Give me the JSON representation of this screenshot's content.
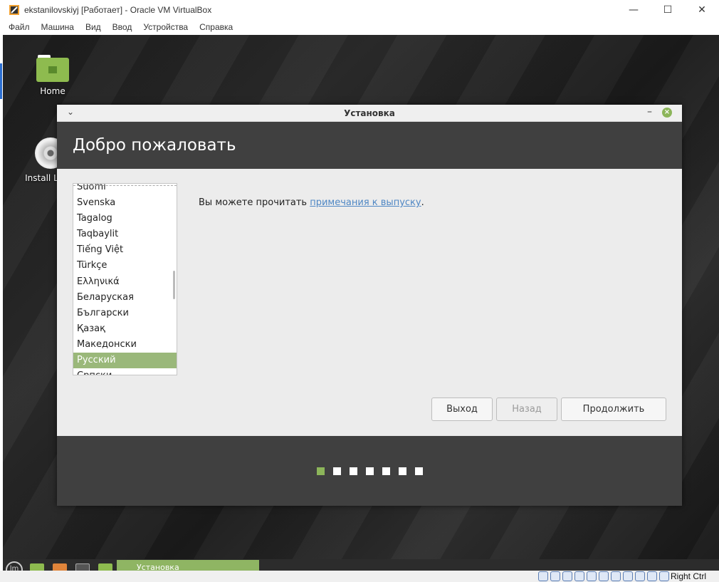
{
  "host": {
    "title": "ekstanilovskiyj [Работает] - Oracle VM VirtualBox",
    "menu": [
      "Файл",
      "Машина",
      "Вид",
      "Ввод",
      "Устройства",
      "Справка"
    ],
    "controls": {
      "minimize": "—",
      "maximize": "☐",
      "close": "✕"
    },
    "status_key": "Right Ctrl"
  },
  "desktop": {
    "icons": [
      {
        "label": "Home",
        "icon": "folder-home-icon"
      },
      {
        "label": "Install L Min",
        "icon": "disc-icon"
      }
    ]
  },
  "dialog": {
    "title": "Установка",
    "heading": "Добро пожаловать",
    "languages": [
      "Suomi",
      "Svenska",
      "Tagalog",
      "Taqbaylit",
      "Tiếng Việt",
      "Türkçe",
      "Ελληνικά",
      "Беларуская",
      "Български",
      "Қазақ",
      "Македонски",
      "Русский",
      "Српски"
    ],
    "selected_language": "Русский",
    "notes_prefix": "Вы можете прочитать ",
    "notes_link": "примечания к выпуску",
    "notes_suffix": ".",
    "buttons": {
      "quit": "Выход",
      "back": "Назад",
      "continue": "Продолжить"
    },
    "progress": {
      "current_step": 1,
      "total_steps": 7
    }
  },
  "taskbar": {
    "task_label": "Установка"
  },
  "colors": {
    "accent": "#8cb55a",
    "dark": "#404040",
    "link": "#4f87c4"
  }
}
